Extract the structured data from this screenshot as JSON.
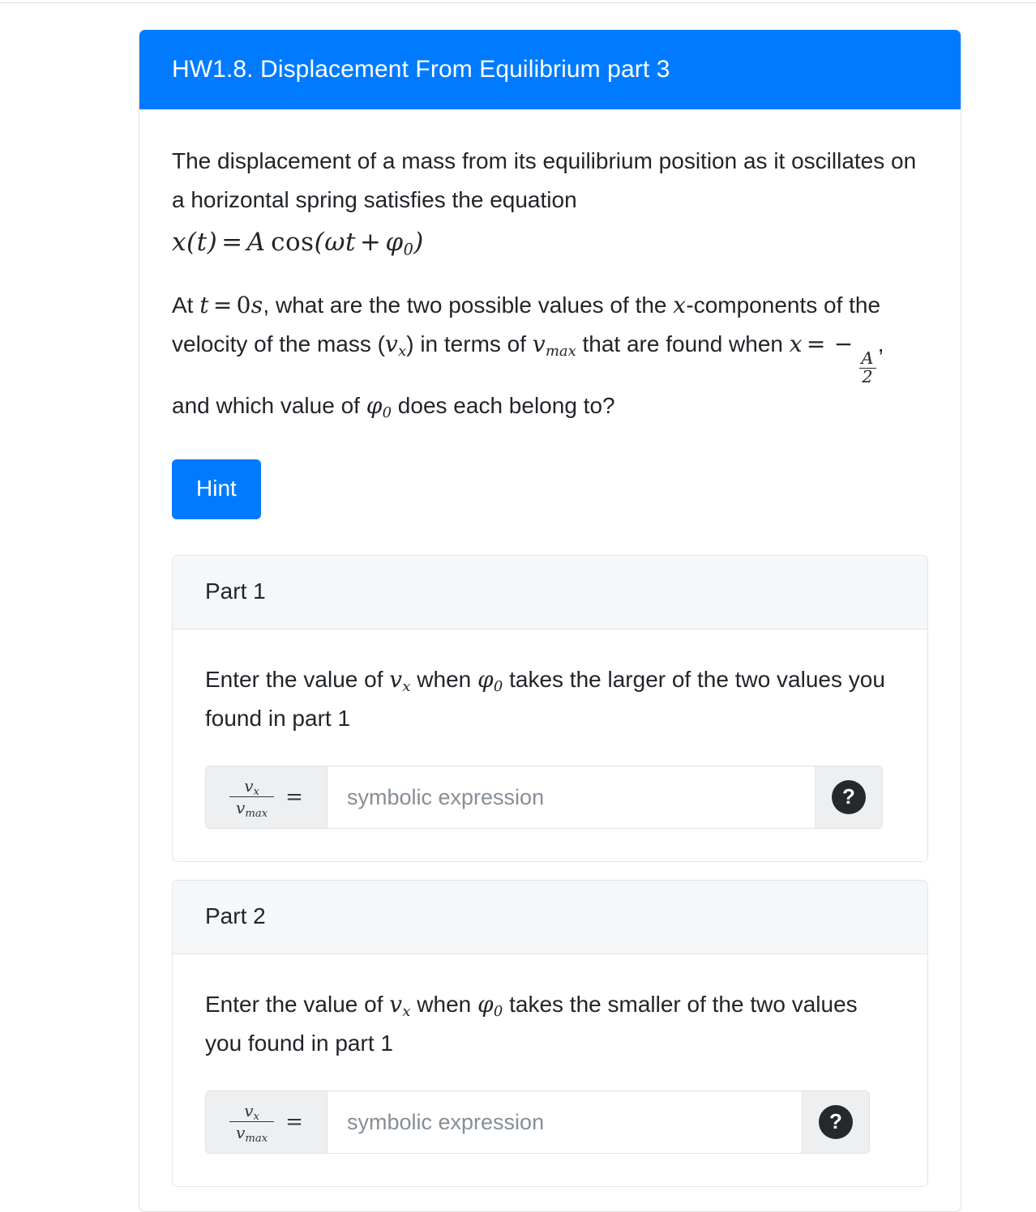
{
  "header": {
    "title": "HW1.8. Displacement From Equilibrium part 3",
    "accent_color": "#007bff"
  },
  "question": {
    "paragraph1_text": "The displacement of a mass from its equilibrium position as it oscillates on a horizontal spring satisfies the equation",
    "equation_display": "x(t) = A cos(ωt + φ0)",
    "equation_parts": {
      "x": "x",
      "t": "t",
      "equals": "=",
      "A": "A",
      "cos": "cos",
      "omega": "ω",
      "plus": "+",
      "phi": "φ",
      "phi_sub": "0"
    },
    "paragraph2": {
      "seg_at": "At ",
      "math_t": "t",
      "math_eq": "=",
      "math_zero": "0",
      "math_s": "s",
      "seg_a": ", what are the two possible values of the ",
      "math_x": "x",
      "seg_b": "-components of the velocity of the mass (",
      "math_v": "v",
      "math_v_sub": "x",
      "seg_c": ") in terms of ",
      "math_vmax": "v",
      "math_vmax_sub": "max",
      "seg_d": " that are found when ",
      "math_x2": "x",
      "math_eq2": "=",
      "math_minus": "−",
      "frac_num": "A",
      "frac_den": "2",
      "seg_e": ", and which value of ",
      "math_phi": "φ",
      "math_phi_sub": "0",
      "seg_f": " does each belong to?"
    }
  },
  "hint": {
    "label": "Hint"
  },
  "parts": [
    {
      "heading": "Part 1",
      "prompt": {
        "seg_a": "Enter the value of ",
        "math_v": "v",
        "math_v_sub": "x",
        "seg_b": " when ",
        "math_phi": "φ",
        "math_phi_sub": "0",
        "seg_c": " takes the larger of the two values you found in part 1"
      },
      "answer": {
        "prefix_numerator": "v",
        "prefix_numerator_sub": "x",
        "prefix_denominator": "v",
        "prefix_denominator_sub": "max",
        "equals": "=",
        "value": "",
        "placeholder": "symbolic expression",
        "help_glyph": "?"
      }
    },
    {
      "heading": "Part 2",
      "prompt": {
        "seg_a": "Enter the value of ",
        "math_v": "v",
        "math_v_sub": "x",
        "seg_b": " when ",
        "math_phi": "φ",
        "math_phi_sub": "0",
        "seg_c": " takes the smaller of the two values you found in part 1"
      },
      "answer": {
        "prefix_numerator": "v",
        "prefix_numerator_sub": "x",
        "prefix_denominator": "v",
        "prefix_denominator_sub": "max",
        "equals": "=",
        "value": "",
        "placeholder": "symbolic expression",
        "help_glyph": "?"
      }
    }
  ]
}
